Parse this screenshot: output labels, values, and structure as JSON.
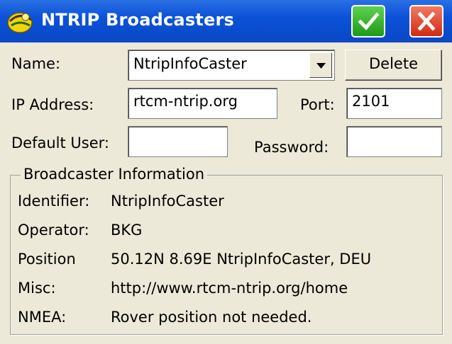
{
  "window": {
    "title": "NTRIP Broadcasters",
    "ok_icon": "checkmark-icon",
    "close_icon": "close-icon"
  },
  "form": {
    "name_label": "Name:",
    "name_value": "NtripInfoCaster",
    "delete_label": "Delete",
    "ip_label": "IP Address:",
    "ip_value": "rtcm-ntrip.org",
    "port_label": "Port:",
    "port_value": "2101",
    "user_label": "Default User:",
    "user_value": "",
    "password_label": "Password:",
    "password_value": ""
  },
  "info": {
    "group_title": "Broadcaster Information",
    "rows": [
      {
        "label": "Identifier:",
        "value": "NtripInfoCaster"
      },
      {
        "label": "Operator:",
        "value": "BKG"
      },
      {
        "label": "Position",
        "value": "50.12N 8.69E NtripInfoCaster, DEU"
      },
      {
        "label": "Misc:",
        "value": "http://www.rtcm-ntrip.org/home"
      },
      {
        "label": "NMEA:",
        "value": "Rover position not needed."
      }
    ]
  },
  "colors": {
    "titlebar": "#0b52d9",
    "ok_button": "#2fa823",
    "close_button": "#d83a22",
    "background": "#ece9d8"
  }
}
